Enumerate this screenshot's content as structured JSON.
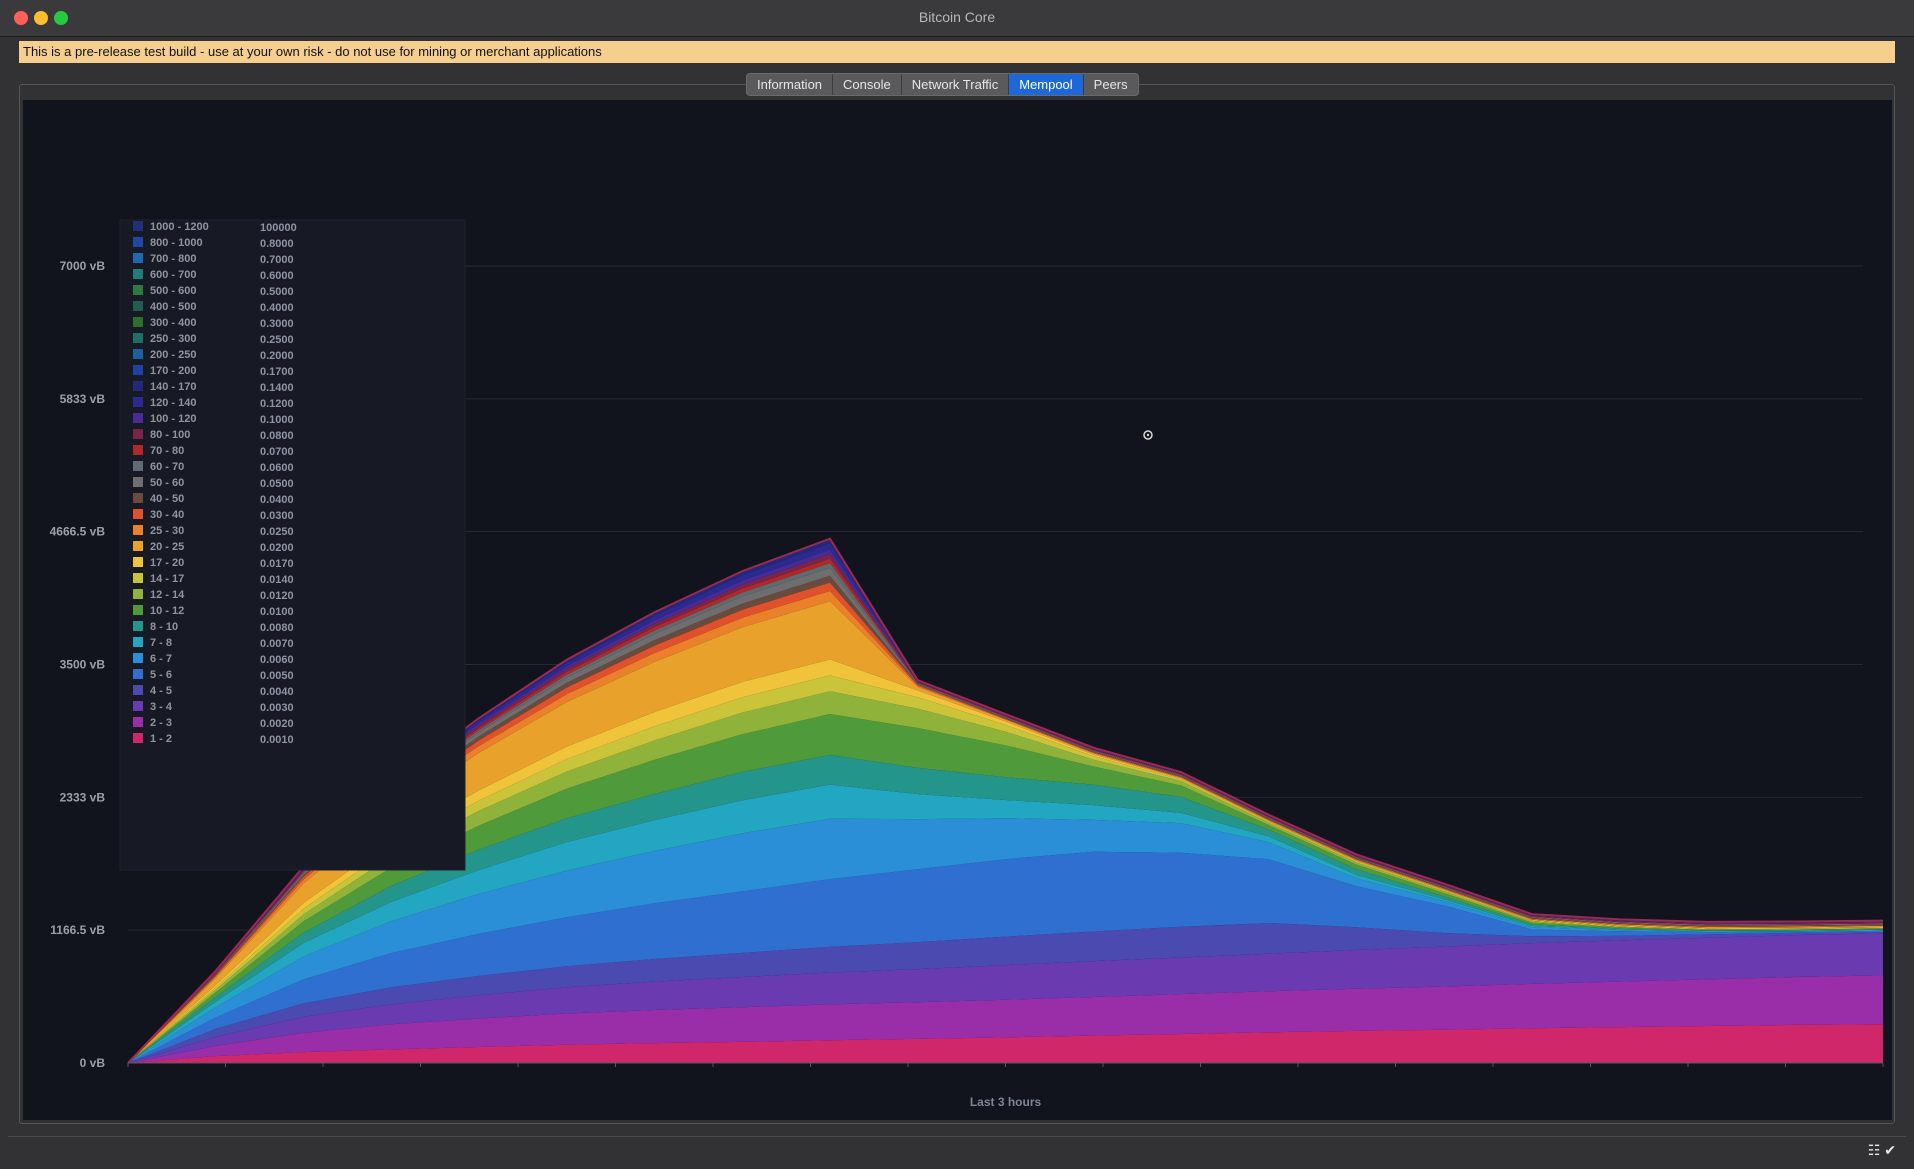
{
  "window": {
    "title": "Bitcoin Core"
  },
  "warning": "This is a pre-release test build - use at your own risk - do not use for mining or merchant applications",
  "tabs": [
    {
      "label": "Information",
      "active": false
    },
    {
      "label": "Console",
      "active": false
    },
    {
      "label": "Network Traffic",
      "active": false
    },
    {
      "label": "Mempool",
      "active": true
    },
    {
      "label": "Peers",
      "active": false
    }
  ],
  "colors": {
    "accent": "#1e67d8",
    "warning_bg": "#f6cf8f",
    "chart_bg": "#11131d"
  },
  "status_icons": [
    "network-icon",
    "sync-check-icon"
  ],
  "chart_data": {
    "type": "area",
    "xlabel": "Last 3 hours",
    "ylabel": "",
    "y_unit": "vB",
    "ylim": [
      0,
      7000
    ],
    "yticks": [
      "0 vB",
      "1166.5 vB",
      "2333 vB",
      "3500 vB",
      "4666.5 vB",
      "5833 vB",
      "7000 vB"
    ],
    "ytick_values": [
      0,
      1166.5,
      2333,
      3500,
      4666.5,
      5833,
      7000
    ],
    "grid": true,
    "legend_position": "top-left",
    "legend": [
      {
        "range": "1000 - 1200",
        "value": "100000",
        "color": "#22307a"
      },
      {
        "range": "800 - 1000",
        "value": "0.8000",
        "color": "#1f47a5"
      },
      {
        "range": "700 - 800",
        "value": "0.7000",
        "color": "#2068b2"
      },
      {
        "range": "600 - 700",
        "value": "0.6000",
        "color": "#1e7f78"
      },
      {
        "range": "500 - 600",
        "value": "0.5000",
        "color": "#2e7a3a"
      },
      {
        "range": "400 - 500",
        "value": "0.4000",
        "color": "#1f5e50"
      },
      {
        "range": "300 - 400",
        "value": "0.3000",
        "color": "#2f6e2c"
      },
      {
        "range": "250 - 300",
        "value": "0.2500",
        "color": "#1f6e68"
      },
      {
        "range": "200 - 250",
        "value": "0.2000",
        "color": "#1e5fa0"
      },
      {
        "range": "170 - 200",
        "value": "0.1700",
        "color": "#1c44a0"
      },
      {
        "range": "140 - 170",
        "value": "0.1400",
        "color": "#22287a"
      },
      {
        "range": "120 - 140",
        "value": "0.1200",
        "color": "#2a2a90"
      },
      {
        "range": "100 - 120",
        "value": "0.1000",
        "color": "#4a2a96"
      },
      {
        "range": "80 - 100",
        "value": "0.0800",
        "color": "#7a2448"
      },
      {
        "range": "70 - 80",
        "value": "0.0700",
        "color": "#b02828"
      },
      {
        "range": "60 - 70",
        "value": "0.0600",
        "color": "#5f6b70"
      },
      {
        "range": "50 - 60",
        "value": "0.0500",
        "color": "#6e6e6e"
      },
      {
        "range": "40 - 50",
        "value": "0.0400",
        "color": "#6b4a3e"
      },
      {
        "range": "30 - 40",
        "value": "0.0300",
        "color": "#e0502a"
      },
      {
        "range": "25 - 30",
        "value": "0.0250",
        "color": "#e8812a"
      },
      {
        "range": "20 - 25",
        "value": "0.0200",
        "color": "#e8a22c"
      },
      {
        "range": "17 - 20",
        "value": "0.0170",
        "color": "#f0c43a"
      },
      {
        "range": "14 - 17",
        "value": "0.0140",
        "color": "#c9c43a"
      },
      {
        "range": "12 - 14",
        "value": "0.0120",
        "color": "#8fb33a"
      },
      {
        "range": "10 - 12",
        "value": "0.0100",
        "color": "#4f9a3a"
      },
      {
        "range": "8 - 10",
        "value": "0.0080",
        "color": "#23958a"
      },
      {
        "range": "7 - 8",
        "value": "0.0070",
        "color": "#23a6c2"
      },
      {
        "range": "6 - 7",
        "value": "0.0060",
        "color": "#2a8fd6"
      },
      {
        "range": "5 - 6",
        "value": "0.0050",
        "color": "#2f6fd0"
      },
      {
        "range": "4 - 5",
        "value": "0.0040",
        "color": "#4a4ab0"
      },
      {
        "range": "3 - 4",
        "value": "0.0030",
        "color": "#6a3ab0"
      },
      {
        "range": "2 - 3",
        "value": "0.0020",
        "color": "#9a2ea8"
      },
      {
        "range": "1 - 2",
        "value": "0.0010",
        "color": "#d0266a"
      }
    ],
    "x": [
      0,
      5,
      10,
      15,
      20,
      25,
      30,
      35,
      40,
      45,
      50,
      55,
      60,
      65,
      70,
      75,
      80,
      85,
      90,
      95,
      100
    ],
    "series": [
      {
        "name": "1 - 2",
        "values": [
          0,
          60,
          95,
          120,
          140,
          160,
          175,
          185,
          200,
          212,
          225,
          240,
          255,
          270,
          282,
          292,
          305,
          315,
          325,
          335,
          340
        ]
      },
      {
        "name": "2 - 3",
        "values": [
          0,
          90,
          170,
          220,
          250,
          275,
          290,
          305,
          315,
          322,
          330,
          340,
          350,
          360,
          370,
          380,
          390,
          400,
          410,
          420,
          430
        ]
      },
      {
        "name": "3 - 4",
        "values": [
          0,
          80,
          140,
          175,
          205,
          230,
          250,
          265,
          280,
          290,
          305,
          315,
          322,
          330,
          340,
          350,
          358,
          362,
          365,
          368,
          370
        ]
      },
      {
        "name": "4 - 5",
        "values": [
          0,
          70,
          120,
          150,
          170,
          185,
          198,
          212,
          225,
          238,
          250,
          260,
          270,
          270,
          200,
          120,
          60,
          40,
          30,
          20,
          10
        ]
      },
      {
        "name": "5 - 6",
        "values": [
          0,
          100,
          210,
          300,
          370,
          430,
          490,
          540,
          595,
          640,
          680,
          700,
          650,
          560,
          360,
          240,
          60,
          40,
          20,
          10,
          10
        ]
      },
      {
        "name": "6 - 7",
        "values": [
          0,
          90,
          200,
          280,
          350,
          410,
          460,
          510,
          530,
          440,
          360,
          280,
          260,
          150,
          70,
          40,
          20,
          10,
          5,
          5,
          5
        ]
      },
      {
        "name": "7 - 8",
        "values": [
          0,
          50,
          120,
          170,
          210,
          250,
          270,
          290,
          300,
          220,
          160,
          130,
          90,
          50,
          30,
          15,
          10,
          5,
          5,
          5,
          5
        ]
      },
      {
        "name": "8 - 10",
        "values": [
          0,
          40,
          90,
          140,
          180,
          210,
          230,
          250,
          260,
          230,
          200,
          180,
          140,
          60,
          50,
          25,
          15,
          10,
          5,
          5,
          5
        ]
      },
      {
        "name": "10 - 12",
        "values": [
          0,
          40,
          100,
          160,
          210,
          260,
          300,
          330,
          360,
          350,
          280,
          160,
          100,
          40,
          40,
          30,
          15,
          10,
          5,
          5,
          5
        ]
      },
      {
        "name": "12 - 14",
        "values": [
          0,
          25,
          60,
          100,
          130,
          150,
          170,
          190,
          200,
          170,
          120,
          60,
          40,
          20,
          20,
          15,
          10,
          5,
          5,
          5,
          5
        ]
      },
      {
        "name": "14 - 17",
        "values": [
          0,
          20,
          50,
          70,
          90,
          110,
          125,
          135,
          140,
          100,
          60,
          30,
          15,
          10,
          10,
          8,
          5,
          5,
          5,
          5,
          5
        ]
      },
      {
        "name": "17 - 20",
        "values": [
          0,
          20,
          50,
          70,
          90,
          110,
          125,
          135,
          140,
          60,
          30,
          15,
          8,
          5,
          5,
          5,
          5,
          5,
          5,
          5,
          5
        ]
      },
      {
        "name": "20 - 25",
        "values": [
          0,
          60,
          170,
          260,
          330,
          390,
          440,
          480,
          510,
          30,
          15,
          10,
          5,
          5,
          5,
          5,
          5,
          5,
          5,
          5,
          5
        ]
      },
      {
        "name": "25 - 30",
        "values": [
          0,
          15,
          35,
          50,
          60,
          70,
          78,
          84,
          90,
          10,
          5,
          5,
          5,
          5,
          5,
          5,
          5,
          5,
          5,
          5,
          5
        ]
      },
      {
        "name": "30 - 40",
        "values": [
          0,
          10,
          25,
          40,
          50,
          58,
          65,
          70,
          75,
          10,
          5,
          5,
          5,
          5,
          5,
          5,
          5,
          5,
          5,
          5,
          5
        ]
      },
      {
        "name": "40 - 50",
        "values": [
          0,
          5,
          15,
          25,
          35,
          42,
          48,
          54,
          60,
          5,
          5,
          5,
          5,
          5,
          5,
          5,
          5,
          5,
          5,
          5,
          5
        ]
      },
      {
        "name": "50 - 60",
        "values": [
          0,
          5,
          15,
          25,
          35,
          45,
          55,
          62,
          70,
          5,
          5,
          5,
          5,
          5,
          5,
          5,
          5,
          5,
          5,
          5,
          5
        ]
      },
      {
        "name": "60 - 70",
        "values": [
          0,
          5,
          10,
          15,
          20,
          25,
          30,
          35,
          40,
          5,
          5,
          5,
          5,
          5,
          5,
          5,
          5,
          5,
          5,
          5,
          5
        ]
      },
      {
        "name": "70 - 80",
        "values": [
          0,
          5,
          10,
          15,
          20,
          25,
          30,
          35,
          40,
          5,
          5,
          5,
          5,
          5,
          5,
          5,
          5,
          5,
          5,
          5,
          5
        ]
      },
      {
        "name": "80 - 100",
        "values": [
          0,
          5,
          10,
          15,
          20,
          25,
          30,
          35,
          40,
          5,
          5,
          5,
          5,
          5,
          5,
          5,
          5,
          5,
          5,
          5,
          5
        ]
      },
      {
        "name": "100 - 120",
        "values": [
          0,
          5,
          10,
          15,
          20,
          25,
          30,
          35,
          40,
          5,
          5,
          5,
          5,
          5,
          5,
          5,
          5,
          5,
          5,
          5,
          5
        ]
      },
      {
        "name": "120 - 140",
        "values": [
          0,
          5,
          10,
          18,
          25,
          32,
          40,
          48,
          55,
          5,
          5,
          5,
          5,
          5,
          5,
          5,
          5,
          5,
          5,
          5,
          5
        ]
      },
      {
        "name": "140 - 170",
        "values": [
          0,
          5,
          10,
          15,
          20,
          25,
          30,
          35,
          40,
          5,
          5,
          5,
          5,
          5,
          5,
          5,
          5,
          5,
          5,
          5,
          5
        ]
      }
    ]
  }
}
